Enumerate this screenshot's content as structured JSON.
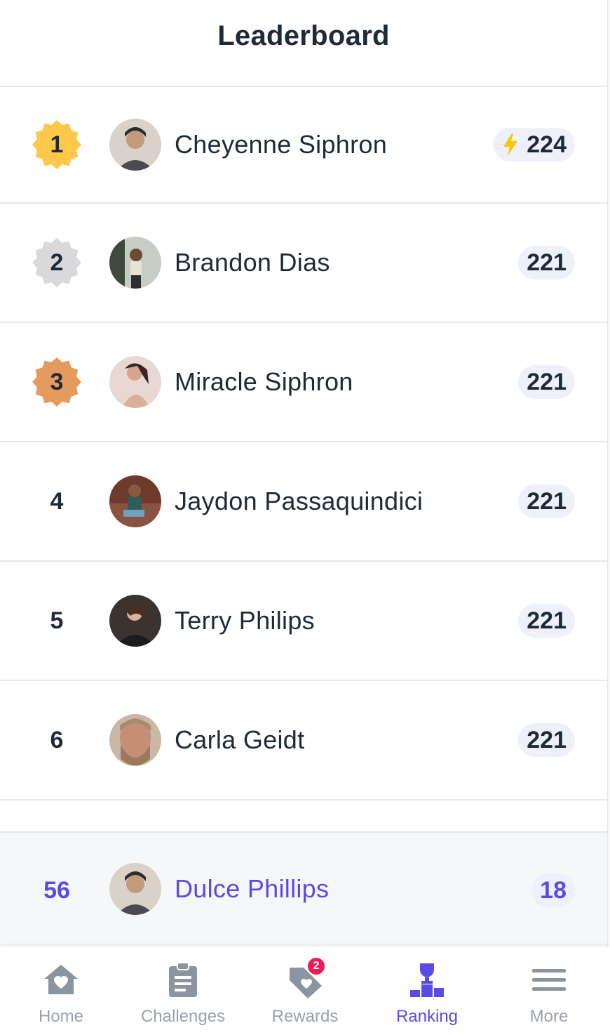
{
  "header": {
    "title": "Leaderboard"
  },
  "colors": {
    "accent": "#5b4be6",
    "gold": "#ffc84a",
    "silver": "#d9d9db",
    "bronze": "#e69b5e",
    "bolt": "#f5c800",
    "badge": "#ee1b55"
  },
  "leaderboard": [
    {
      "rank": "1",
      "medal": "gold",
      "name": "Cheyenne Siphron",
      "score": "224",
      "streak_icon": "lightning-bolt-icon"
    },
    {
      "rank": "2",
      "medal": "silver",
      "name": "Brandon Dias",
      "score": "221"
    },
    {
      "rank": "3",
      "medal": "bronze",
      "name": "Miracle Siphron",
      "score": "221"
    },
    {
      "rank": "4",
      "name": "Jaydon Passaquindici",
      "score": "221"
    },
    {
      "rank": "5",
      "name": "Terry Philips",
      "score": "221"
    },
    {
      "rank": "6",
      "name": "Carla Geidt",
      "score": "221"
    }
  ],
  "current_user": {
    "rank": "56",
    "name": "Dulce Phillips",
    "score": "18"
  },
  "tabs": [
    {
      "label": "Home",
      "icon": "home-heart-icon"
    },
    {
      "label": "Challenges",
      "icon": "clipboard-icon"
    },
    {
      "label": "Rewards",
      "icon": "tag-heart-icon",
      "badge": "2"
    },
    {
      "label": "Ranking",
      "icon": "trophy-podium-icon",
      "active": true
    },
    {
      "label": "More",
      "icon": "hamburger-menu-icon"
    }
  ]
}
